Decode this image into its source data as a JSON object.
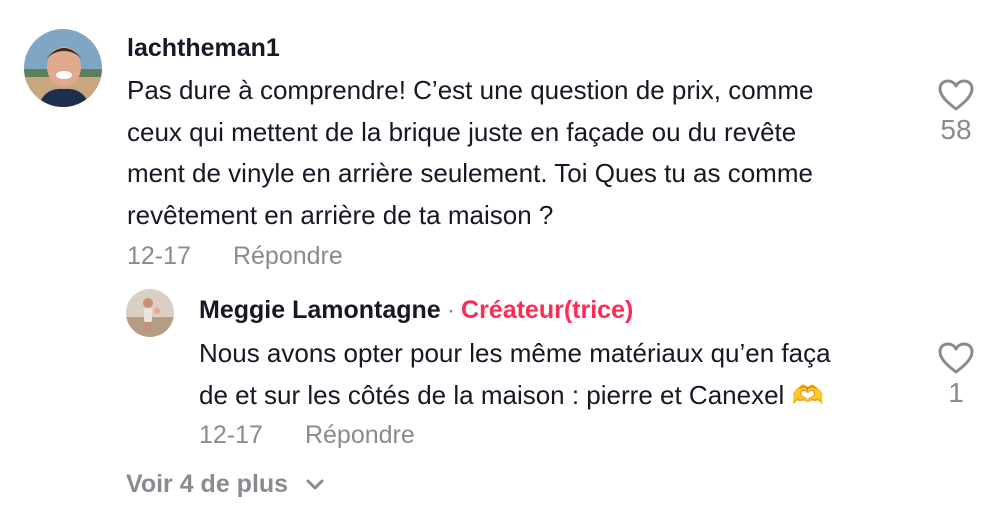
{
  "comments": [
    {
      "username": "lachtheman1",
      "text_lines": [
        "Pas dure à comprendre! C’est une question de prix, comme",
        "ceux qui mettent de la brique juste en façade ou du revête",
        "ment de vinyle en arrière seulement. Toi Ques tu as comme",
        "revêtement en arrière de ta maison ?"
      ],
      "date": "12-17",
      "reply_label": "Répondre",
      "likes": "58",
      "like_icon": "heart-outline-icon"
    }
  ],
  "reply": {
    "username": "Meggie Lamontagne",
    "separator": "·",
    "badge": "Créateur(trice)",
    "text_lines": [
      "Nous avons opter pour les même matériaux qu’en faça",
      "de et sur les côtés de la maison : pierre et Canexel 🫶"
    ],
    "date": "12-17",
    "reply_label": "Répondre",
    "likes": "1",
    "like_icon": "heart-outline-icon"
  },
  "view_more": {
    "label": "Voir 4 de plus",
    "icon": "chevron-down-icon"
  },
  "colors": {
    "text": "#161823",
    "muted": "#8a8b91",
    "creator": "#fe2c55"
  }
}
